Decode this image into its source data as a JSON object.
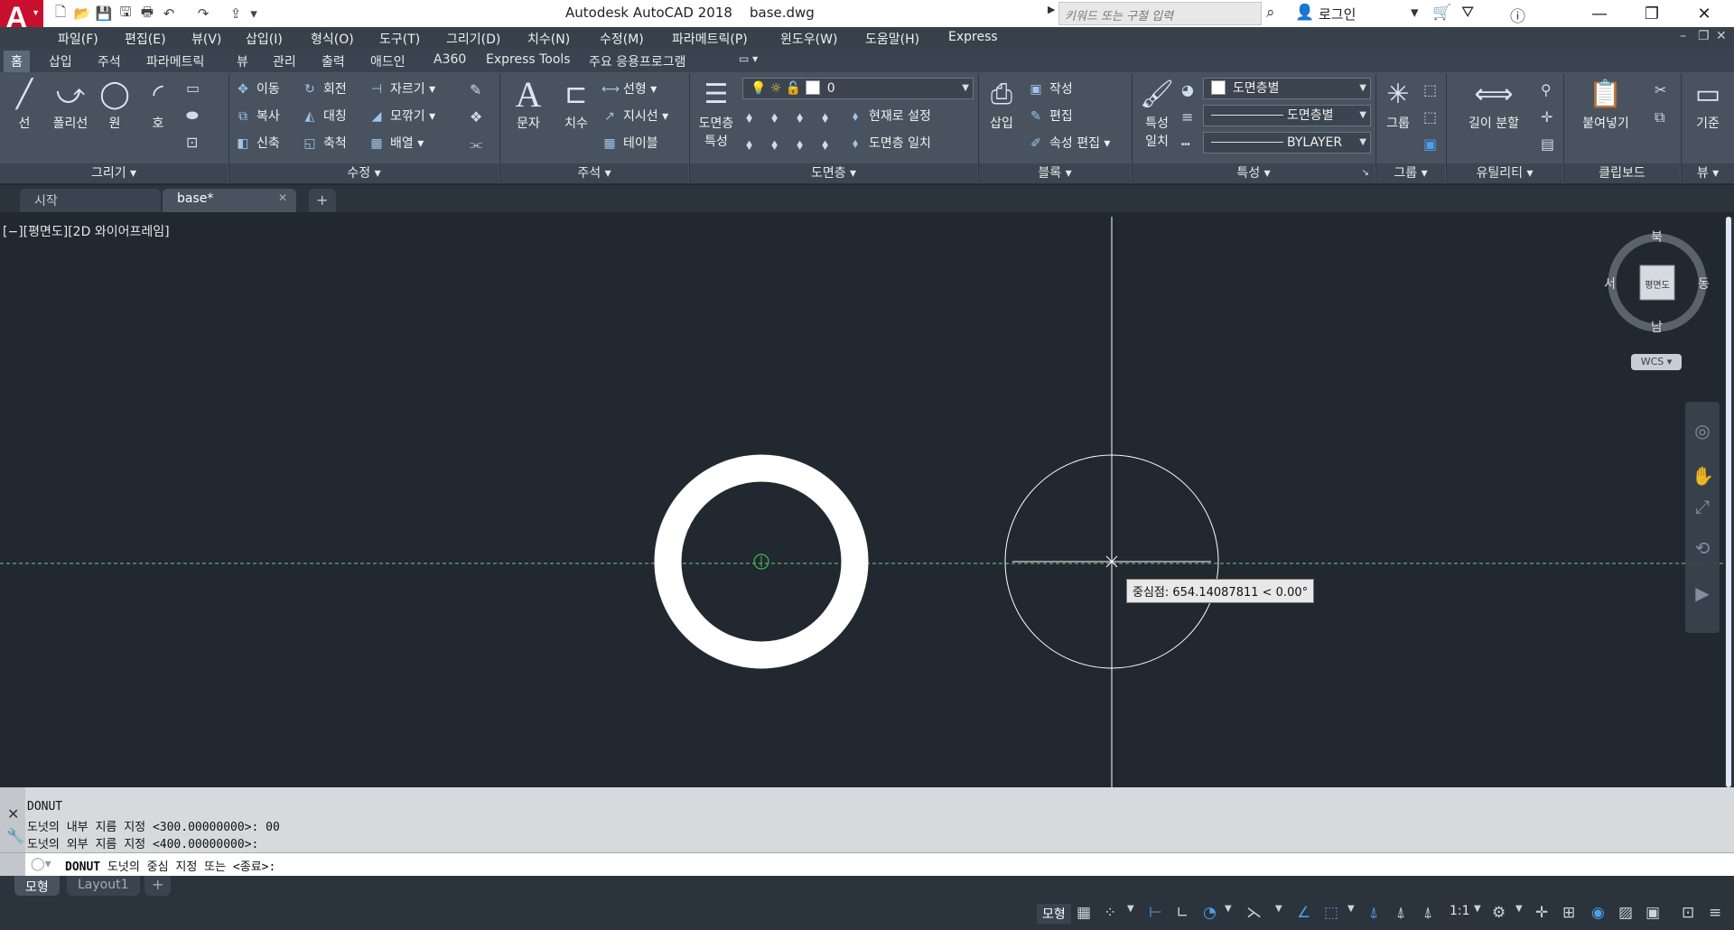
{
  "app": {
    "title": "Autodesk AutoCAD 2018",
    "filename": "base.dwg",
    "logo_letter": "A",
    "search_placeholder": "키워드 또는 구절 입력",
    "login": "로그인"
  },
  "menu": [
    "파일(F)",
    "편집(E)",
    "뷰(V)",
    "삽입(I)",
    "형식(O)",
    "도구(T)",
    "그리기(D)",
    "치수(N)",
    "수정(M)",
    "파라메트릭(P)",
    "윈도우(W)",
    "도움말(H)",
    "Express"
  ],
  "ribbon_tabs": [
    "홈",
    "삽입",
    "주석",
    "파라메트릭",
    "뷰",
    "관리",
    "출력",
    "애드인",
    "A360",
    "Express Tools",
    "주요 응용프로그램"
  ],
  "ribbon": {
    "draw": {
      "title": "그리기",
      "line": "선",
      "polyline": "폴리선",
      "circle": "원",
      "arc": "호"
    },
    "modify": {
      "title": "수정",
      "move": "이동",
      "rotate": "회전",
      "trim": "자르기",
      "copy": "복사",
      "mirror": "대칭",
      "fillet": "모깎기",
      "stretch": "신축",
      "scale": "축척",
      "array": "배열"
    },
    "annotation": {
      "title": "주석",
      "text": "문자",
      "dimension": "치수",
      "linear": "선형",
      "leader": "지시선",
      "table": "테이블"
    },
    "layers": {
      "title": "도면층",
      "properties_line1": "도면층",
      "properties_line2": "특성",
      "current_layer": "0",
      "make_current": "현재로 설정",
      "match_layer": "도면층 일치"
    },
    "block": {
      "title": "블록",
      "insert": "삽입",
      "create": "작성",
      "edit": "편집",
      "edit_attributes": "속성 편집"
    },
    "properties": {
      "title": "특성",
      "match_line1": "특성",
      "match_line2": "일치",
      "color": "도면층별",
      "linetype": "도면층별",
      "lineweight": "BYLAYER"
    },
    "groups": {
      "title": "그룹",
      "group": "그룹"
    },
    "utilities": {
      "title": "유틸리티",
      "measure": "길이 분할"
    },
    "clipboard": {
      "title": "클립보드",
      "paste": "붙여넣기"
    },
    "view": {
      "title": "뷰",
      "base": "기준"
    }
  },
  "file_tabs": [
    {
      "label": "시작"
    },
    {
      "label": "base*"
    }
  ],
  "viewport": {
    "label": "[−][평면도][2D 와이어프레임]",
    "tooltip": "중심점: 654.14087811 < 0.00°",
    "compass": {
      "n": "북",
      "s": "남",
      "e": "동",
      "w": "서",
      "face": "평면도"
    },
    "wcs": "WCS"
  },
  "command": {
    "history": [
      "DONUT",
      "도넛의 내부 지름 지정 <300.00000000>: 00",
      "도넛의 외부 지름 지정 <400.00000000>:"
    ],
    "prompt_cmd": "DONUT",
    "prompt_text": "도넛의 중심 지정 또는 <종료>:"
  },
  "layout_tabs": [
    "모형",
    "Layout1"
  ],
  "status": {
    "model": "모형",
    "scale": "1:1"
  }
}
